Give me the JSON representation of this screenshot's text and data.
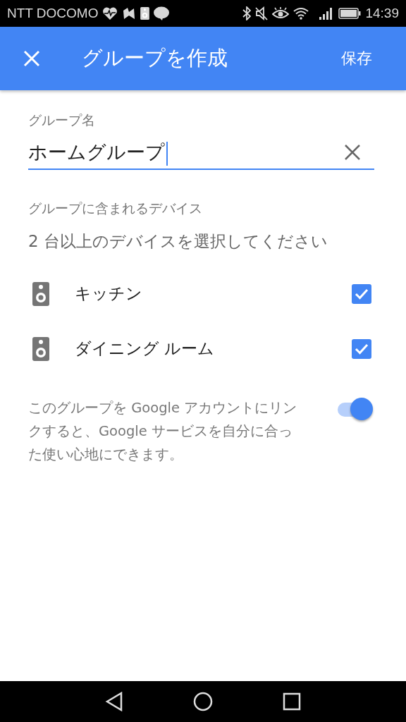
{
  "status_bar": {
    "carrier": "NTT DOCOMO",
    "time": "14:39"
  },
  "app_bar": {
    "title": "グループを作成",
    "save": "保存"
  },
  "group_name": {
    "label": "グループ名",
    "value": "ホームグループ",
    "focused": true
  },
  "devices": {
    "heading": "グループに含まれるデバイス",
    "hint": "2 台以上のデバイスを選択してください",
    "items": [
      {
        "name": "キッチン",
        "checked": true
      },
      {
        "name": "ダイニング ルーム",
        "checked": true
      }
    ]
  },
  "link_account": {
    "text": "このグループを Google アカウントにリンクすると、Google サービスを自分に合った使い心地にできます。",
    "on": true
  }
}
